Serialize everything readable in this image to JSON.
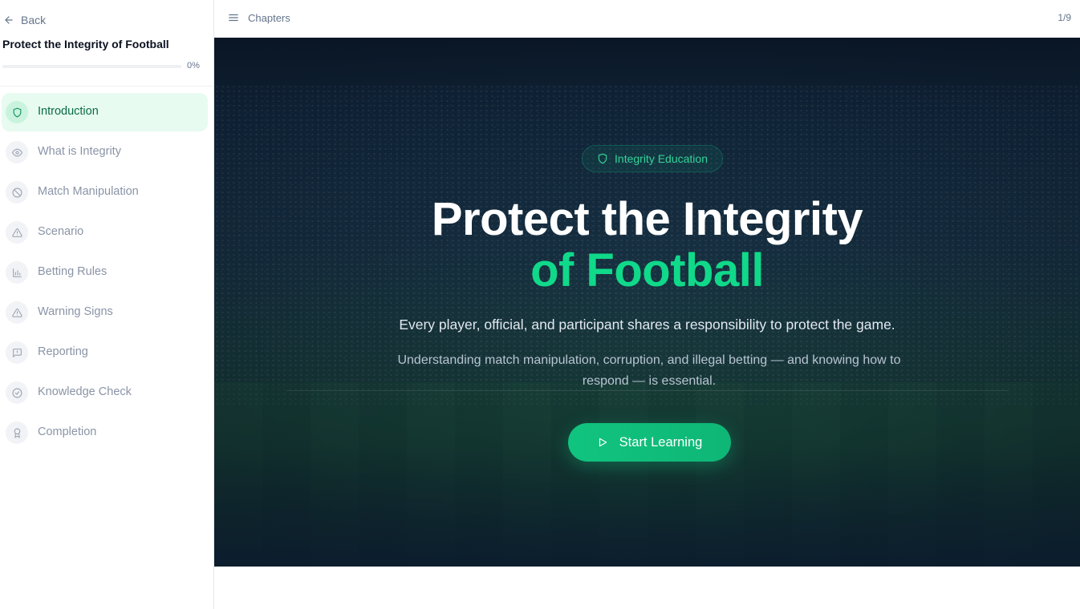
{
  "sidebar": {
    "back_label": "Back",
    "course_title": "Protect the Integrity of Football",
    "progress_percent": "0%",
    "progress_value": 0,
    "chapters": [
      {
        "label": "Introduction",
        "icon": "shield-icon",
        "active": true
      },
      {
        "label": "What is Integrity",
        "icon": "eye-icon",
        "active": false
      },
      {
        "label": "Match Manipulation",
        "icon": "ban-icon",
        "active": false
      },
      {
        "label": "Scenario",
        "icon": "warning-triangle-icon",
        "active": false
      },
      {
        "label": "Betting Rules",
        "icon": "bar-chart-icon",
        "active": false
      },
      {
        "label": "Warning Signs",
        "icon": "warning-triangle-icon",
        "active": false
      },
      {
        "label": "Reporting",
        "icon": "message-square-icon",
        "active": false
      },
      {
        "label": "Knowledge Check",
        "icon": "check-circle-icon",
        "active": false
      },
      {
        "label": "Completion",
        "icon": "award-icon",
        "active": false
      }
    ]
  },
  "topbar": {
    "chapters_label": "Chapters",
    "page_counter": "1/9"
  },
  "hero": {
    "badge_label": "Integrity Education",
    "title_line1": "Protect the Integrity",
    "title_line2": "of Football",
    "lead": "Every player, official, and participant shares a responsibility to protect the game.",
    "sub": "Understanding match manipulation, corruption, and illegal betting — and knowing how to respond — is essential.",
    "cta_label": "Start Learning"
  },
  "colors": {
    "accent": "#10d98a",
    "active_bg": "#e7fbf1",
    "active_text": "#0b6b47"
  }
}
